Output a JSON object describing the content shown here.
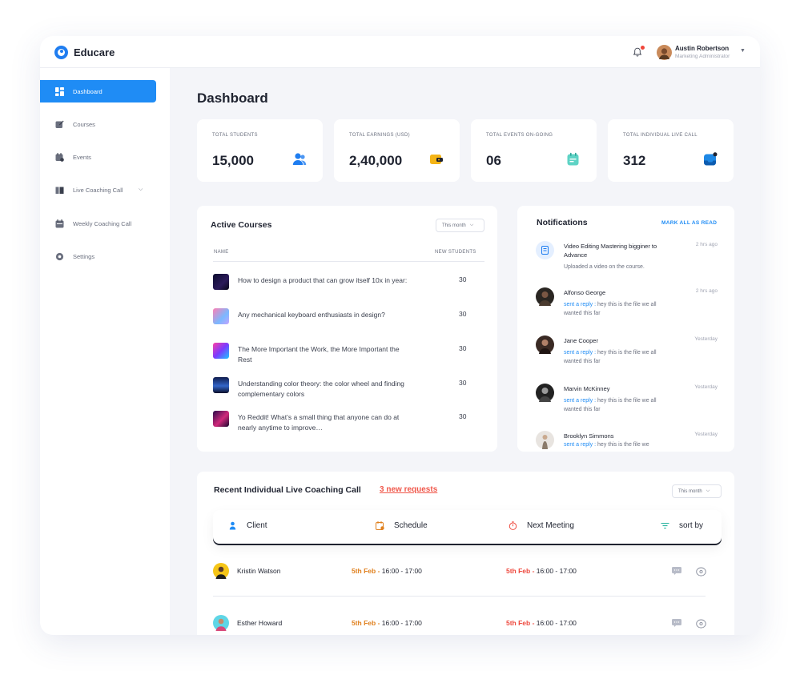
{
  "app": {
    "name": "Educare",
    "user": {
      "name": "Austin Robertson",
      "role": "Marketing Administrator"
    }
  },
  "sidebar": {
    "items": [
      {
        "label": "Dashboard",
        "icon": "dashboard-icon",
        "active": true
      },
      {
        "label": "Courses",
        "icon": "courses-icon",
        "active": false
      },
      {
        "label": "Events",
        "icon": "calendar-icon",
        "active": false
      },
      {
        "label": "Live Coaching Call",
        "icon": "book-icon",
        "active": false
      },
      {
        "label": "Weekly Coaching Call",
        "icon": "weekly-calendar-icon",
        "active": false
      },
      {
        "label": "Settings",
        "icon": "gear-icon",
        "active": false
      }
    ]
  },
  "page": {
    "title": "Dashboard"
  },
  "stats": [
    {
      "label": "TOTAL STUDENTS",
      "value": "15,000",
      "icon": "students-icon"
    },
    {
      "label": "TOTAL EARNINGS (USD)",
      "value": "2,40,000",
      "icon": "wallet-icon"
    },
    {
      "label": "TOTAL EVENTS ON-GOING",
      "value": "06",
      "icon": "event-icon"
    },
    {
      "label": "TOTAL INDIVIDUAL LIVE CALL",
      "value": "312",
      "icon": "inbox-icon"
    }
  ],
  "active_courses": {
    "title": "Active Courses",
    "filter": "This month",
    "col_name": "NAME",
    "col_students": "NEW STUDENTS",
    "rows": [
      {
        "name": "How to design a product that can grow itself 10x in year:",
        "students": "30"
      },
      {
        "name": "Any mechanical keyboard enthusiasts in design?",
        "students": "30"
      },
      {
        "name": "The More Important the Work, the More Important the Rest",
        "students": "30"
      },
      {
        "name": "Understanding color theory: the color wheel and finding complementary colors",
        "students": "30"
      },
      {
        "name": "Yo Reddit! What’s a small thing that anyone can do at nearly anytime to improve…",
        "students": "30"
      }
    ]
  },
  "notifications": {
    "title": "Notifications",
    "mark_all": "MARK ALL AS READ",
    "items": [
      {
        "title": "Video Editing Mastering bigginer to Advance",
        "time": "2 hrs ago",
        "body": "Uploaded a video on the course.",
        "link": ""
      },
      {
        "title": "Alfonso George",
        "time": "2 hrs ago",
        "link": "sent a reply :",
        "body": "hey this is the file we all wanted this far"
      },
      {
        "title": "Jane Cooper",
        "time": "Yesterday",
        "link": "sent a reply :",
        "body": "hey this is the file we all wanted this far"
      },
      {
        "title": "Marvin McKinney",
        "time": "Yesterday",
        "link": "sent a reply :",
        "body": "hey this is the file we all wanted this far"
      },
      {
        "title": "Brooklyn Simmons",
        "time": "Yesterday",
        "link": "sent a reply :",
        "body": "hey this is the file we"
      }
    ]
  },
  "coaching": {
    "title": "Recent Individual Live Coaching Call",
    "requests": "3 new requests",
    "filter": "This month",
    "headers": {
      "client": "Client",
      "schedule": "Schedule",
      "next": "Next Meeting",
      "sort": "sort by"
    },
    "rows": [
      {
        "name": "Kristin Watson",
        "s_date": "5th Feb -",
        "s_time": "16:00 - 17:00",
        "n_date": "5th Feb -",
        "n_time": "16:00 - 17:00"
      },
      {
        "name": "Esther Howard",
        "s_date": "5th Feb -",
        "s_time": "16:00 - 17:00",
        "n_date": "5th Feb -",
        "n_time": "16:00 - 17:00"
      }
    ]
  },
  "colors": {
    "accent": "#1f8cf5",
    "danger": "#f0584b",
    "warning": "#e0801e"
  }
}
